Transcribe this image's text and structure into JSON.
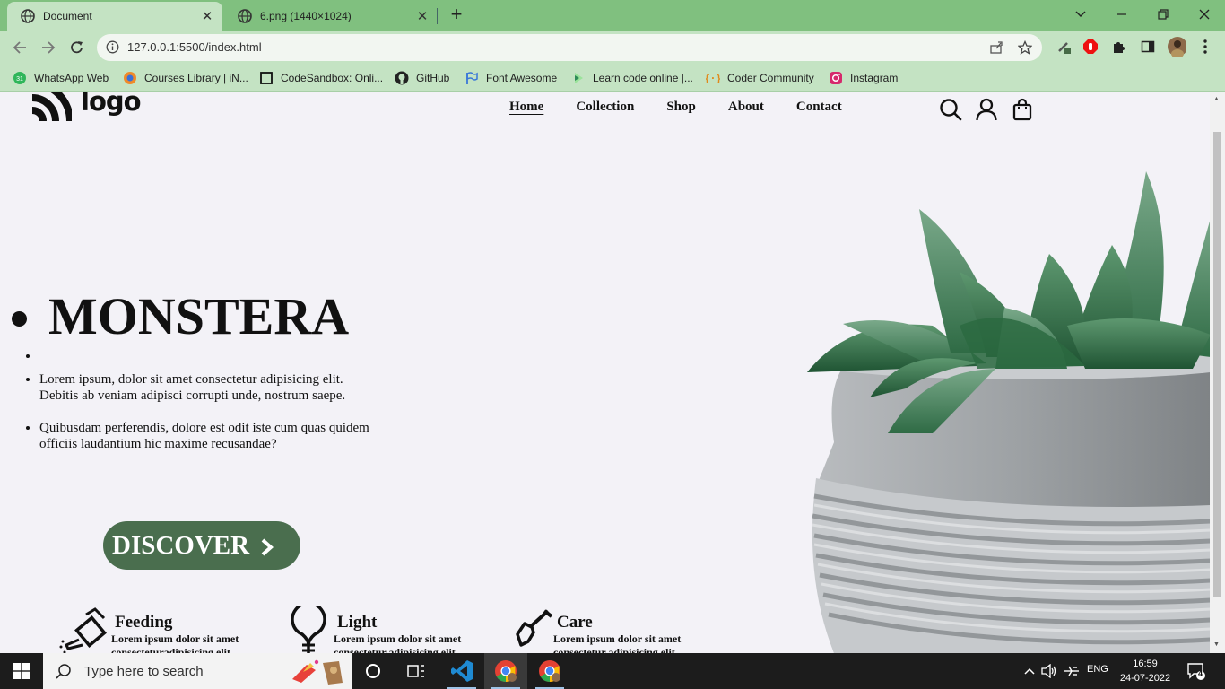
{
  "browser": {
    "tabs": [
      {
        "title": "Document",
        "active": true
      },
      {
        "title": "6.png (1440×1024)",
        "active": false
      }
    ],
    "new_tab": "+",
    "url": "127.0.0.1:5500/index.html",
    "bookmarks": [
      {
        "label": "WhatsApp Web",
        "icon": "whatsapp-icon"
      },
      {
        "label": "Courses Library | iN...",
        "icon": "courses-icon"
      },
      {
        "label": "CodeSandbox: Onli...",
        "icon": "codesandbox-icon"
      },
      {
        "label": "GitHub",
        "icon": "github-icon"
      },
      {
        "label": "Font Awesome",
        "icon": "flag-icon"
      },
      {
        "label": "Learn code online |...",
        "icon": "learn-icon"
      },
      {
        "label": "Coder Community",
        "icon": "coder-icon"
      },
      {
        "label": "Instagram",
        "icon": "instagram-icon"
      }
    ]
  },
  "page": {
    "logo": "logo",
    "nav": [
      "Home",
      "Collection",
      "Shop",
      "About",
      "Contact"
    ],
    "nav_current": "Home",
    "hero": {
      "title": "MONSTERA",
      "paragraphs": [
        "Lorem ipsum, dolor sit amet consectetur adipisicing elit. Debitis ab veniam adipisci corrupti unde, nostrum saepe.",
        "Quibusdam perferendis, dolore est odit iste cum quas quidem officiis laudantium hic maxime recusandae?"
      ],
      "cta": "DISCOVER"
    },
    "features": [
      {
        "title": "Feeding",
        "text": "Lorem ipsum dolor sit amet consecteturadipisicing elit.",
        "icon": "watering-can-icon"
      },
      {
        "title": "Light",
        "text": "Lorem ipsum dolor sit amet consectetur adipisicing elit.",
        "icon": "lightbulb-icon"
      },
      {
        "title": "Care",
        "text": "Lorem ipsum dolor sit amet consectetur adipisicing elit.",
        "icon": "shovel-icon"
      }
    ],
    "colors": {
      "accent": "#4a6e4e",
      "background": "#f3f2f7"
    }
  },
  "taskbar": {
    "search_placeholder": "Type here to search",
    "language": "ENG",
    "time": "16:59",
    "date": "24-07-2022",
    "notifications": "4"
  }
}
